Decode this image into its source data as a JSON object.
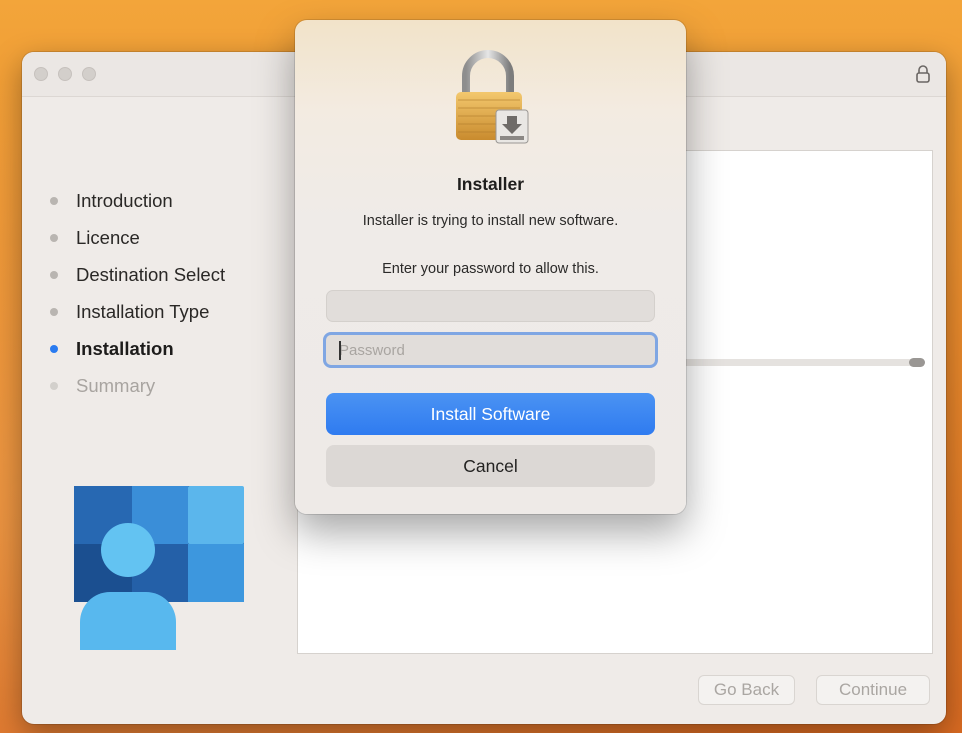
{
  "installer": {
    "steps": [
      {
        "label": "Introduction",
        "state": "done"
      },
      {
        "label": "Licence",
        "state": "done"
      },
      {
        "label": "Destination Select",
        "state": "done"
      },
      {
        "label": "Installation Type",
        "state": "done"
      },
      {
        "label": "Installation",
        "state": "active"
      },
      {
        "label": "Summary",
        "state": "pending"
      }
    ],
    "footer": {
      "go_back": "Go Back",
      "continue": "Continue"
    },
    "progress": 1.0
  },
  "auth_dialog": {
    "title": "Installer",
    "message": "Installer is trying to install new software.",
    "prompt": "Enter your password to allow this.",
    "username_value": "",
    "password_placeholder": "Password",
    "primary_button": "Install Software",
    "cancel_button": "Cancel"
  },
  "icons": {
    "window_lock": "lock-icon",
    "dialog_lock": "padlock-installer-icon",
    "app_logo": "company-portal-logo"
  },
  "colors": {
    "accent": "#2f7bf0",
    "active_step_dot": "#2a7bf0",
    "desktop": "#e98a2c"
  }
}
